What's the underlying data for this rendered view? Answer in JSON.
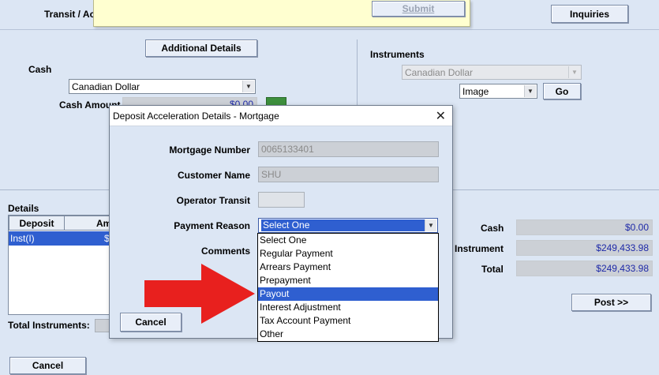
{
  "top": {
    "transit_label": "Transit / Ac",
    "submit_label": "Submit",
    "inquiries_label": "Inquiries"
  },
  "additional_details_label": "Additional Details",
  "cash": {
    "section_label": "Cash",
    "currency": "Canadian Dollar",
    "amount_label": "Cash Amount",
    "amount_value": "$0.00"
  },
  "instruments": {
    "section_label": "Instruments",
    "currency": "Canadian Dollar",
    "type": "Image",
    "go_label": "Go"
  },
  "details": {
    "section_label": "Details",
    "columns": [
      "Deposit",
      "Am"
    ],
    "rows": [
      {
        "deposit": "Inst(I)",
        "amount": "$"
      }
    ],
    "total_instruments_label": "Total Instruments:",
    "cancel_label": "Cancel"
  },
  "totals": {
    "cash_label": "Cash",
    "cash_value": "$0.00",
    "instrument_label": "Instrument",
    "instrument_value": "$249,433.98",
    "total_label": "Total",
    "total_value": "$249,433.98",
    "post_label": "Post >>"
  },
  "dialog": {
    "title": "Deposit Acceleration Details - Mortgage",
    "mortgage_number_label": "Mortgage Number",
    "mortgage_number_value": "0065133401",
    "customer_name_label": "Customer Name",
    "customer_name_value": "SHU",
    "operator_transit_label": "Operator Transit",
    "operator_transit_value": "",
    "payment_reason_label": "Payment Reason",
    "payment_reason_selected": "Select One",
    "comments_label": "Comments",
    "cancel_label": "Cancel",
    "options": [
      "Select One",
      "Regular Payment",
      "Arrears Payment",
      "Prepayment",
      "Payout",
      "Interest Adjustment",
      "Tax Account Payment",
      "Other"
    ],
    "highlighted_option": "Payout"
  },
  "colors": {
    "background": "#dce6f4",
    "highlight": "#2f5fd0",
    "amount_text": "#1f2aa8",
    "arrow": "#e8201e"
  },
  "icons": {
    "calculator": "calculator-icon",
    "close": "close-icon",
    "arrow": "red-arrow-annotation"
  }
}
